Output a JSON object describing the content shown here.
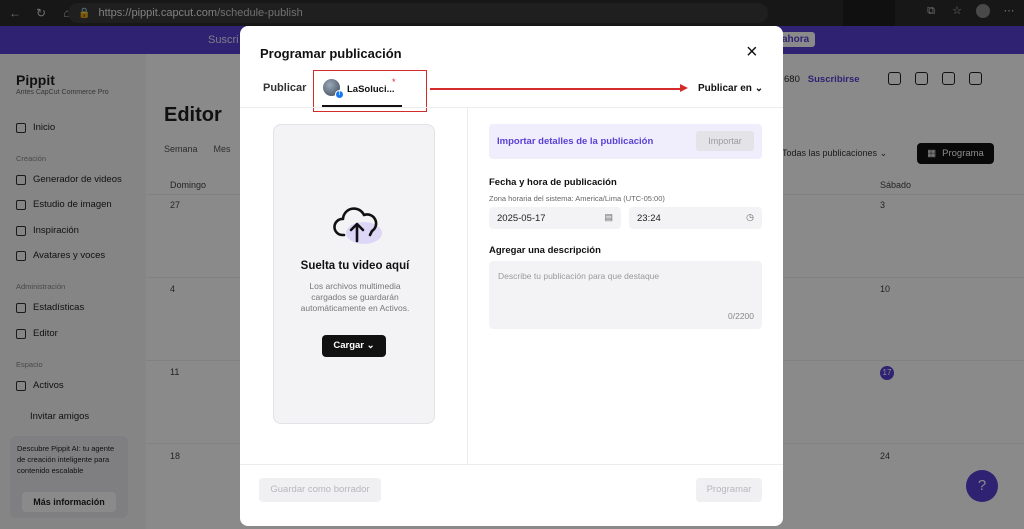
{
  "browser": {
    "url_host": "https://pippit.capcut.com",
    "url_path": "/schedule-publish"
  },
  "banner": {
    "text": "Suscri",
    "button": "ahora"
  },
  "app": {
    "logo": "Pippit",
    "logo_sub": "Antes CapCut Commerce Pro",
    "nav": {
      "inicio": "Inicio",
      "creacion_section": "Creación",
      "generador": "Generador de videos",
      "estudio": "Estudio de imagen",
      "inspiracion": "Inspiración",
      "avatares": "Avatares y voces",
      "admin_section": "Administración",
      "estadisticas": "Estadísticas",
      "editor": "Editor",
      "espacio_section": "Espacio",
      "activos": "Activos",
      "invitar": "Invitar amigos"
    },
    "promo": {
      "text": "Descubre Pippit AI: tu agente de creación inteligente para contenido escalable",
      "button": "Más información"
    },
    "page_title": "Editor",
    "tabs": [
      "Semana",
      "Mes"
    ],
    "filter": "Todas las publicaciones",
    "schedule_button": "Programa",
    "credits": "680",
    "subscribe": "Suscribirse",
    "calendar": {
      "sunday": "Domingo",
      "saturday": "Sábado",
      "days_left": [
        "27",
        "4",
        "11",
        "18"
      ],
      "days_right": [
        "3",
        "10",
        "17",
        "24"
      ]
    }
  },
  "modal": {
    "title": "Programar publicación",
    "tab_publish": "Publicar",
    "account_name": "LaSoluci...",
    "required_mark": "*",
    "publish_on": "Publicar en",
    "dropzone": {
      "title": "Suelta tu video aquí",
      "description": "Los archivos multimedia cargados se guardarán automáticamente en Activos.",
      "upload_button": "Cargar"
    },
    "import": {
      "label": "Importar detalles de la publicación",
      "button": "Importar"
    },
    "datetime": {
      "label": "Fecha y hora de publicación",
      "timezone": "Zona horaria del sistema: America/Lima (UTC-05:00)",
      "date": "2025-05-17",
      "time": "23:24"
    },
    "description": {
      "label": "Agregar una descripción",
      "placeholder": "Describe tu publicación para que destaque",
      "counter": "0/2200"
    },
    "footer": {
      "draft": "Guardar como borrador",
      "schedule": "Programar"
    }
  },
  "colors": {
    "accent": "#5a3fd4",
    "annotation_red": "#d42b2b"
  }
}
